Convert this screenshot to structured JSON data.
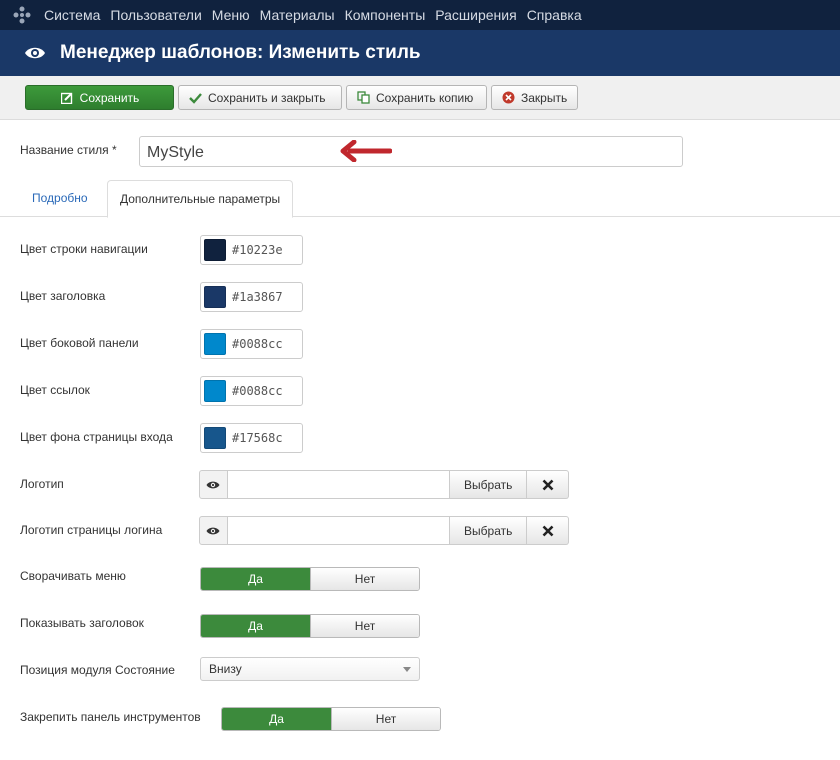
{
  "nav": {
    "items": [
      "Система",
      "Пользователи",
      "Меню",
      "Материалы",
      "Компоненты",
      "Расширения",
      "Справка"
    ]
  },
  "header": {
    "title": "Менеджер шаблонов: Изменить стиль",
    "icon": "eye-icon"
  },
  "toolbar": {
    "save": "Сохранить",
    "save_close": "Сохранить и закрыть",
    "save_copy": "Сохранить копию",
    "close": "Закрыть"
  },
  "form": {
    "style_name_label": "Название стиля *",
    "style_name_value": "MyStyle"
  },
  "tabs": [
    "Подробно",
    "Дополнительные параметры"
  ],
  "params": {
    "colors": [
      {
        "label": "Цвет строки навигации",
        "value": "#10223e"
      },
      {
        "label": "Цвет заголовка",
        "value": "#1a3867"
      },
      {
        "label": "Цвет боковой панели",
        "value": "#0088cc"
      },
      {
        "label": "Цвет ссылок",
        "value": "#0088cc"
      },
      {
        "label": "Цвет фона страницы входа",
        "value": "#17568c"
      }
    ],
    "logo_label": "Логотип",
    "login_logo_label": "Логотип страницы логина",
    "select_button": "Выбрать",
    "collapse_menu_label": "Сворачивать меню",
    "show_header_label": "Показывать заголовок",
    "status_position_label": "Позиция модуля Состояние",
    "status_position_value": "Внизу",
    "pin_toolbar_label": "Закрепить панель инструментов",
    "yes": "Да",
    "no": "Нет"
  }
}
